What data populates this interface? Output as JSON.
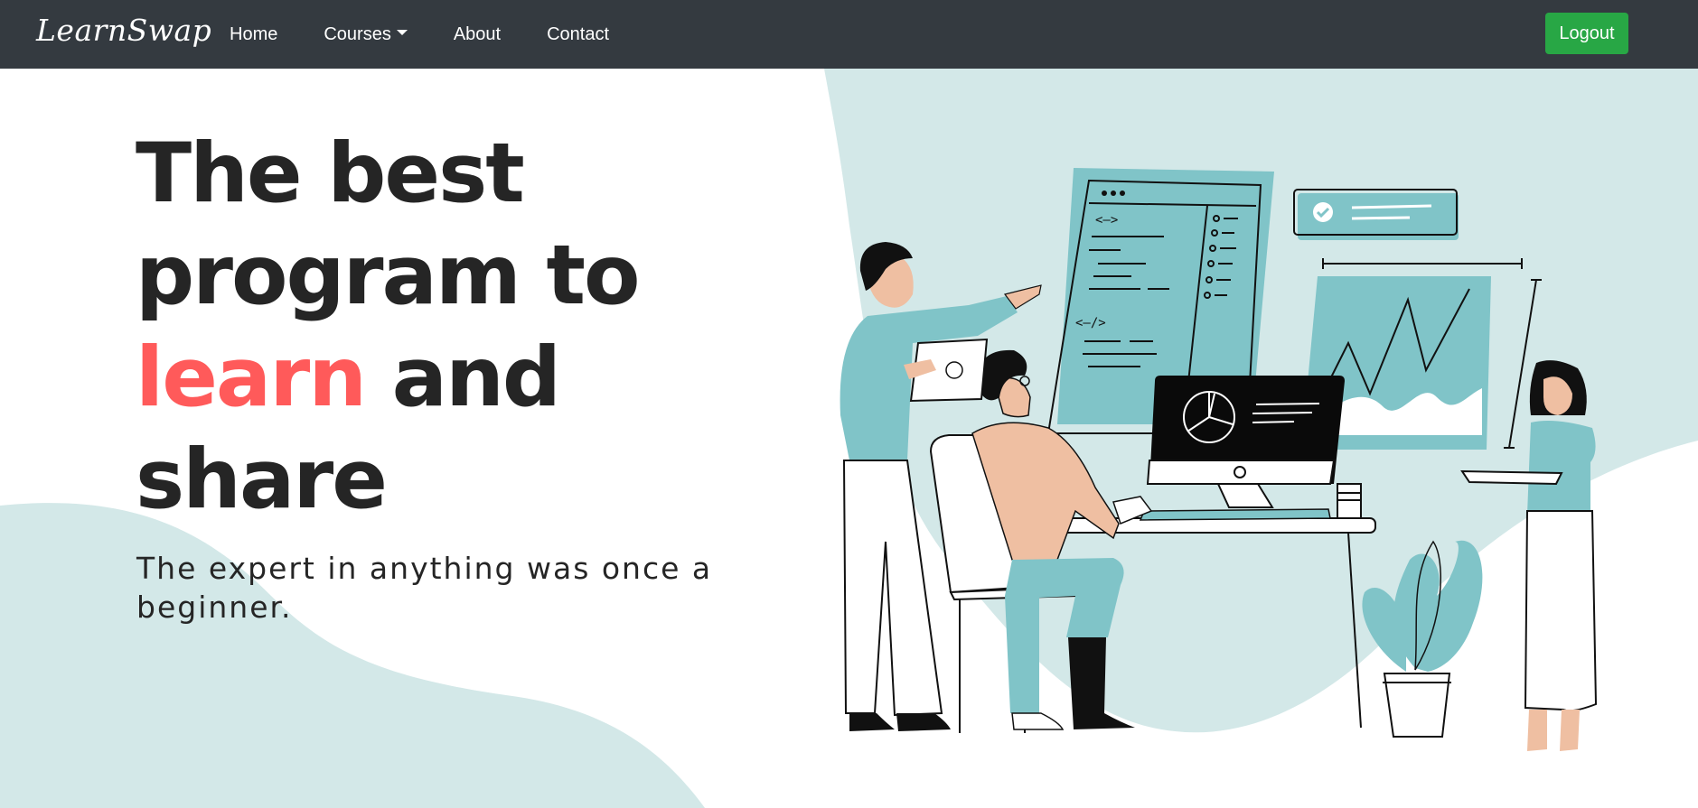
{
  "nav": {
    "brand": "LearnSwap",
    "items": [
      {
        "label": "Home"
      },
      {
        "label": "Courses"
      },
      {
        "label": "About"
      },
      {
        "label": "Contact"
      }
    ],
    "logout_label": "Logout"
  },
  "hero": {
    "title_line1": "The best",
    "title_line2": "program to",
    "title_highlight": "learn",
    "title_line3_rest": " and",
    "title_line4": "share",
    "tagline": "The expert in anything was once a beginner."
  },
  "colors": {
    "navbar": "#343a40",
    "accent_green": "#28a745",
    "highlight": "#ff5a5a",
    "teal_light": "#d3e8e8",
    "teal": "#80c4c8"
  },
  "illustration": {
    "screen_code_1": "<—>",
    "screen_code_2": "<—/>"
  }
}
